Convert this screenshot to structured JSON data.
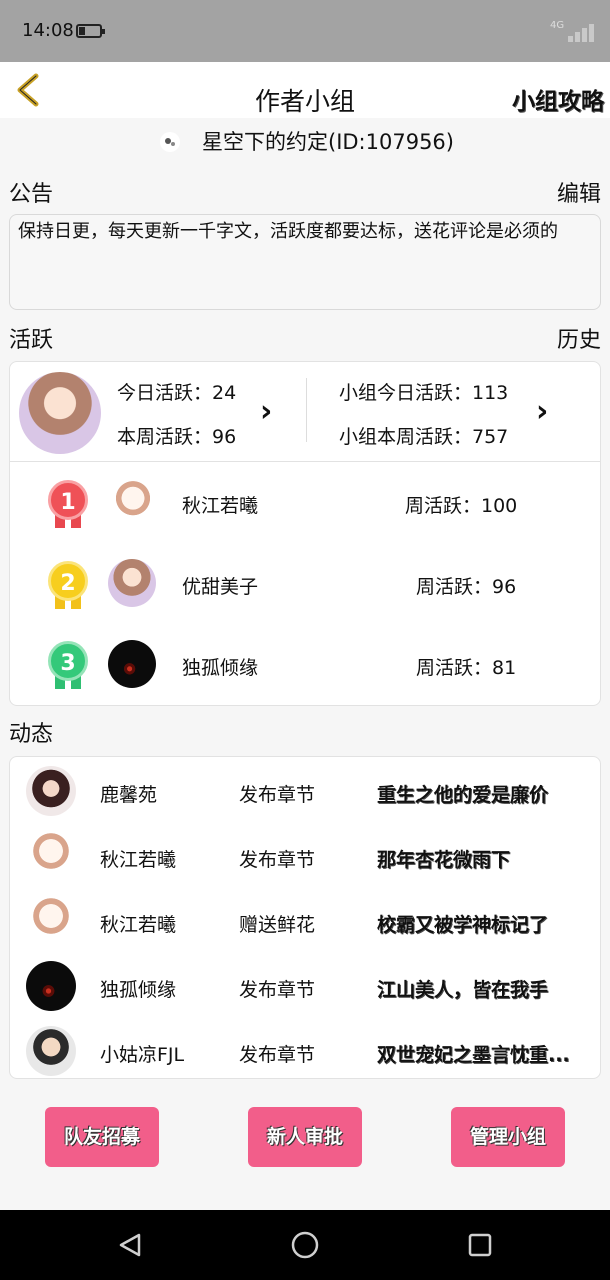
{
  "status": {
    "time": "14:08",
    "network": "4G"
  },
  "header": {
    "title": "作者小组",
    "guide": "小组攻略"
  },
  "group": {
    "name": "星空下的约定(ID:107956)"
  },
  "notice": {
    "label": "公告",
    "edit": "编辑",
    "text": "保持日更，每天更新一千字文，活跃度都要达标，送花评论是必须的"
  },
  "activity": {
    "label": "活跃",
    "history": "历史",
    "today": "今日活跃：24",
    "week": "本周活跃：96",
    "group_today": "小组今日活跃：113",
    "group_week": "小组本周活跃：757"
  },
  "ranking": [
    {
      "rank": "1",
      "name": "秋江若曦",
      "value": "周活跃：100"
    },
    {
      "rank": "2",
      "name": "优甜美子",
      "value": "周活跃：96"
    },
    {
      "rank": "3",
      "name": "独孤倾缘",
      "value": "周活跃：81"
    }
  ],
  "feed": {
    "label": "动态",
    "items": [
      {
        "name": "鹿馨苑",
        "action": "发布章节",
        "title": "重生之他的爱是廉价"
      },
      {
        "name": "秋江若曦",
        "action": "发布章节",
        "title": "那年杏花微雨下"
      },
      {
        "name": "秋江若曦",
        "action": "赠送鲜花",
        "title": "校霸又被学神标记了"
      },
      {
        "name": "独孤倾缘",
        "action": "发布章节",
        "title": "江山美人，皆在我手"
      },
      {
        "name": "小姑凉FJL",
        "action": "发布章节",
        "title": "双世宠妃之墨言忱重..."
      }
    ]
  },
  "buttons": {
    "recruit": "队友招募",
    "approve": "新人审批",
    "manage": "管理小组"
  },
  "colors": {
    "accent": "#f25e8a",
    "back_arrow": "#c9a227"
  }
}
